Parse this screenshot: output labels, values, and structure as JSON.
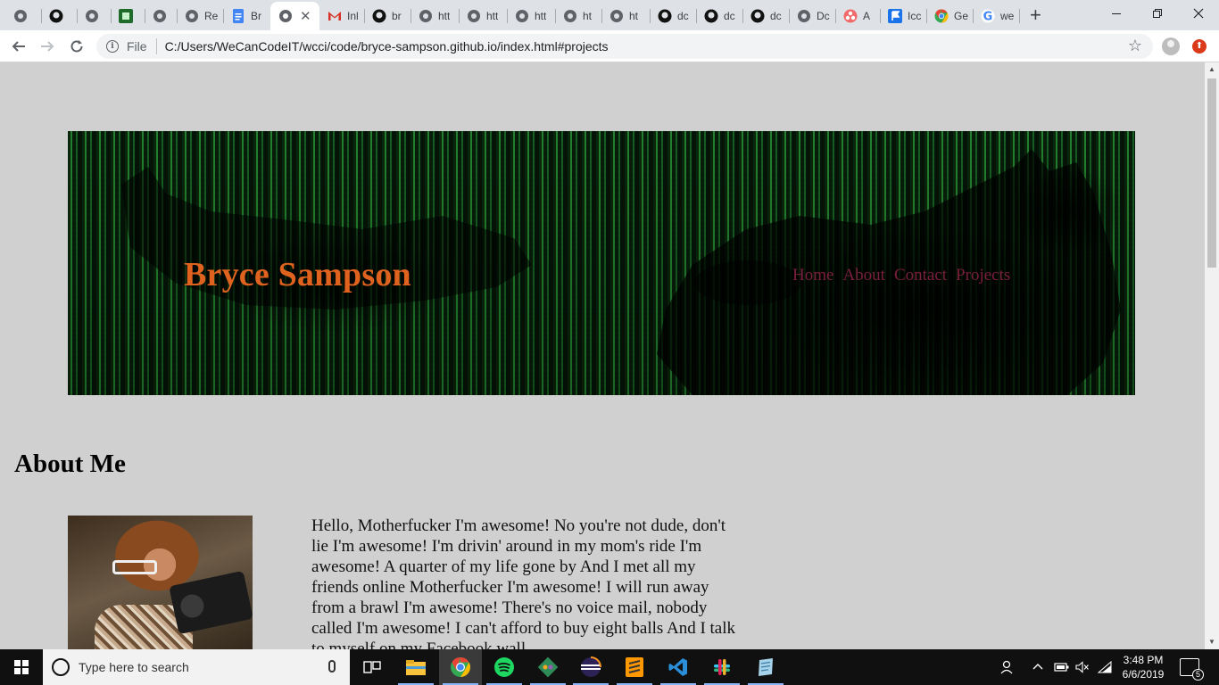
{
  "browser": {
    "tabs": [
      {
        "title": "",
        "icon": "generic-globe-icon"
      },
      {
        "title": "",
        "icon": "github-icon"
      },
      {
        "title": "",
        "icon": "generic-globe-icon"
      },
      {
        "title": "",
        "icon": "app-icon-green"
      },
      {
        "title": "",
        "icon": "generic-globe-icon"
      },
      {
        "title": "Re",
        "icon": "generic-globe-icon"
      },
      {
        "title": "Br",
        "icon": "google-docs-icon"
      },
      {
        "title": "",
        "icon": "generic-globe-icon",
        "active": true
      },
      {
        "title": "Inl",
        "icon": "gmail-icon"
      },
      {
        "title": "br",
        "icon": "github-icon"
      },
      {
        "title": "htt",
        "icon": "generic-globe-icon"
      },
      {
        "title": "htt",
        "icon": "generic-globe-icon"
      },
      {
        "title": "htt",
        "icon": "generic-globe-icon"
      },
      {
        "title": "ht",
        "icon": "generic-globe-icon"
      },
      {
        "title": "ht",
        "icon": "generic-globe-icon"
      },
      {
        "title": "dc",
        "icon": "github-icon"
      },
      {
        "title": "dc",
        "icon": "github-icon"
      },
      {
        "title": "dc",
        "icon": "github-icon"
      },
      {
        "title": "Dc",
        "icon": "generic-globe-icon"
      },
      {
        "title": "A",
        "icon": "asana-icon"
      },
      {
        "title": "Icc",
        "icon": "flag-icon"
      },
      {
        "title": "Ge",
        "icon": "chrome-icon"
      },
      {
        "title": "we",
        "icon": "google-icon"
      }
    ],
    "new_tab_label": "+",
    "address": {
      "scheme_label": "File",
      "url": "C:/Users/WeCanCodeIT/wcci/code/bryce-sampson.github.io/index.html#projects"
    },
    "extension_badge": "⬆"
  },
  "page": {
    "site_title": "Bryce Sampson",
    "nav": [
      "Home",
      "About",
      "Contact",
      "Projects"
    ],
    "about_heading": "About Me",
    "about_text": "Hello, Motherfucker I'm awesome! No you're not dude, don't lie I'm awesome! I'm drivin' around in my mom's ride I'm awesome! A quarter of my life gone by And I met all my friends online Motherfucker I'm awesome! I will run away from a brawl I'm awesome! There's no voice mail, nobody called I'm awesome! I can't afford to buy eight balls And I talk to myself on my Facebook wall"
  },
  "taskbar": {
    "search_placeholder": "Type here to search",
    "apps": [
      "task-view",
      "file-explorer",
      "chrome",
      "spotify",
      "gitkraken",
      "eclipse",
      "sublime-text",
      "vscode",
      "slack",
      "notepad-app"
    ],
    "time": "3:48 PM",
    "date": "6/6/2019",
    "notification_count": "5"
  },
  "colors": {
    "site_title": "#e0621f",
    "nav_link": "#7a1f3d",
    "page_bg": "#d0d0d0"
  }
}
